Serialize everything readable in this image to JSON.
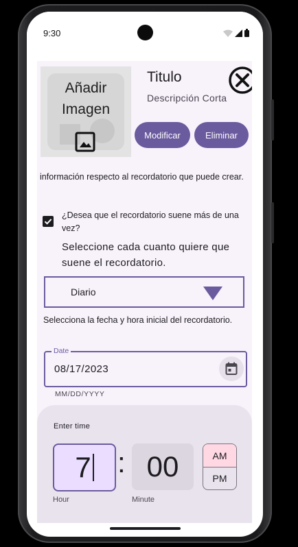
{
  "status": {
    "time": "9:30"
  },
  "header": {
    "image_placeholder": "Añadir\nImagen",
    "title": "Titulo",
    "subtitle": "Descripción Corta",
    "modify_label": "Modificar",
    "delete_label": "Eliminar"
  },
  "body": {
    "info": "información respecto al recordatorio que puede crear.",
    "repeat_checkbox_label": "¿Desea que el recordatorio suene más de una vez?",
    "repeat_checked": true,
    "frequency_prompt": "Seleccione cada cuanto quiere que suene el recordatorio.",
    "frequency_selected": "Diario",
    "date_prompt": "Selecciona la fecha y hora inicial del recordatorio."
  },
  "date_field": {
    "label": "Date",
    "value": "08/17/2023",
    "hint": "MM/DD/YYYY"
  },
  "time_picker": {
    "title": "Enter time",
    "hour": "7",
    "separator": ":",
    "minute": "00",
    "am": "AM",
    "pm": "PM",
    "selected_period": "AM",
    "hour_caption": "Hour",
    "minute_caption": "Minute"
  },
  "colors": {
    "accent": "#6a5a9e",
    "background": "#f8f2fb",
    "am_selected": "#ffd8e4"
  },
  "icons": [
    "image-icon",
    "close-circle-icon",
    "dropdown-arrow-icon",
    "calendar-icon",
    "checkbox-icon",
    "wifi-icon",
    "signal-icon",
    "battery-icon"
  ]
}
